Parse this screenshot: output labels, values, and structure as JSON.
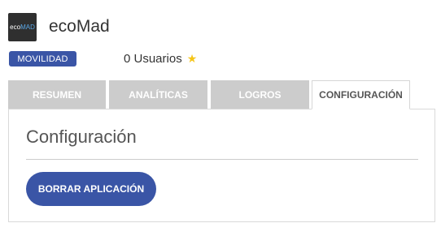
{
  "app": {
    "logo": {
      "part1": "eco",
      "part2": "MAD"
    },
    "name": "ecoMad",
    "category_badge": "MOVILIDAD",
    "users_text": "0 Usuarios",
    "users_icon": "star-icon"
  },
  "tabs": [
    {
      "label": "RESUMEN",
      "active": false
    },
    {
      "label": "ANALÍTICAS",
      "active": false
    },
    {
      "label": "LOGROS",
      "active": false
    },
    {
      "label": "CONFIGURACIÓN",
      "active": true
    }
  ],
  "panel": {
    "title": "Configuración",
    "delete_button": "BORRAR APLICACIÓN"
  },
  "colors": {
    "brand_blue": "#3a55a6",
    "tab_inactive": "#cccccc",
    "star": "#f5c518",
    "logo_accent": "#5aa7e6"
  }
}
